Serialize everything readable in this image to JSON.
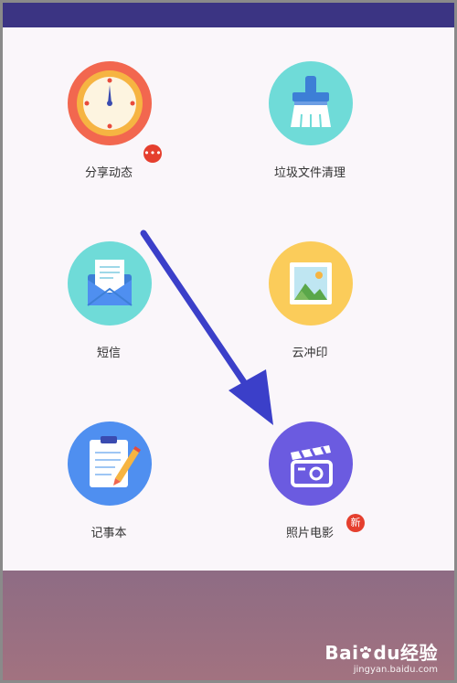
{
  "tiles": [
    {
      "id": "share",
      "label": "分享动态",
      "icon": "clock-icon",
      "color": "#f2674f",
      "badge": "•••"
    },
    {
      "id": "cleanup",
      "label": "垃圾文件清理",
      "icon": "brush-icon",
      "color": "#6fdbd8"
    },
    {
      "id": "sms",
      "label": "短信",
      "icon": "envelope-icon",
      "color": "#6fdbd8"
    },
    {
      "id": "print",
      "label": "云冲印",
      "icon": "photo-icon",
      "color": "#fbcc5a"
    },
    {
      "id": "notes",
      "label": "记事本",
      "icon": "clipboard-icon",
      "color": "#4f8ff0"
    },
    {
      "id": "movie",
      "label": "照片电影",
      "icon": "clapperboard-icon",
      "color": "#6b5be0",
      "badge": "新"
    }
  ],
  "watermark": {
    "brand": "Bai",
    "brand2": "du",
    "suffix": "经验",
    "url": "jingyan.baidu.com"
  },
  "colors": {
    "topbar": "#3b3483",
    "arrow": "#3b3fc9",
    "bottom_start": "#8e6c84",
    "bottom_end": "#a27280"
  }
}
